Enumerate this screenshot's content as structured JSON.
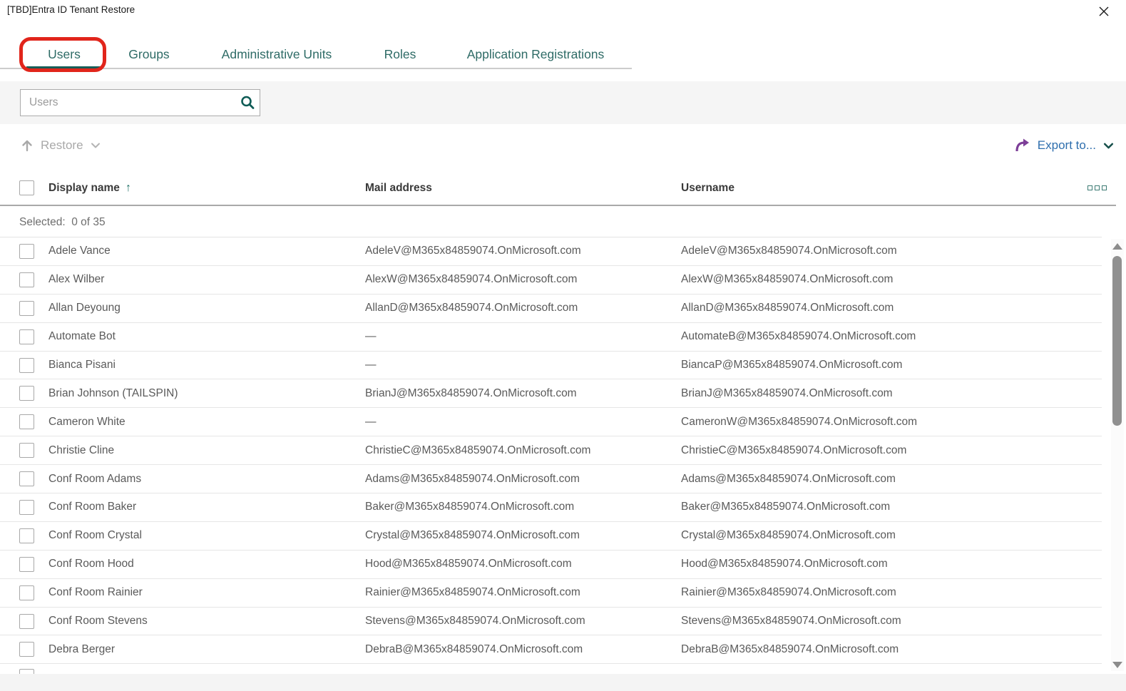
{
  "window": {
    "title": "[TBD]Entra ID Tenant Restore"
  },
  "tabs": [
    {
      "label": "Users",
      "active": true,
      "annotated": true
    },
    {
      "label": "Groups",
      "active": false
    },
    {
      "label": "Administrative Units",
      "active": false
    },
    {
      "label": "Roles",
      "active": false
    },
    {
      "label": "Application Registrations",
      "active": false
    }
  ],
  "search": {
    "placeholder": "Users",
    "icon": "search-icon"
  },
  "toolbar": {
    "restore_label": "Restore",
    "restore_enabled": false,
    "export_label": "Export to...",
    "icons": [
      "up-arrow-icon",
      "chevron-down-icon",
      "export-arrow-icon"
    ]
  },
  "colors": {
    "accent_teal": "#175e58",
    "annotation_red": "#e1251b",
    "export_blue": "#2f6fae",
    "export_purple": "#7d3f98",
    "disabled_grey": "#a9a9a9"
  },
  "table": {
    "columns": [
      "Display name",
      "Mail address",
      "Username"
    ],
    "sort": {
      "column": "Display name",
      "direction": "ascending"
    },
    "selected_summary": "Selected:  0 of 35",
    "rows": [
      {
        "display_name": "Adele Vance",
        "mail": "AdeleV@M365x84859074.OnMicrosoft.com",
        "username": "AdeleV@M365x84859074.OnMicrosoft.com"
      },
      {
        "display_name": "Alex Wilber",
        "mail": "AlexW@M365x84859074.OnMicrosoft.com",
        "username": "AlexW@M365x84859074.OnMicrosoft.com"
      },
      {
        "display_name": "Allan Deyoung",
        "mail": "AllanD@M365x84859074.OnMicrosoft.com",
        "username": "AllanD@M365x84859074.OnMicrosoft.com"
      },
      {
        "display_name": "Automate Bot",
        "mail": "—",
        "username": "AutomateB@M365x84859074.OnMicrosoft.com"
      },
      {
        "display_name": "Bianca Pisani",
        "mail": "—",
        "username": "BiancaP@M365x84859074.OnMicrosoft.com"
      },
      {
        "display_name": "Brian Johnson (TAILSPIN)",
        "mail": "BrianJ@M365x84859074.OnMicrosoft.com",
        "username": "BrianJ@M365x84859074.OnMicrosoft.com"
      },
      {
        "display_name": "Cameron White",
        "mail": "—",
        "username": "CameronW@M365x84859074.OnMicrosoft.com"
      },
      {
        "display_name": "Christie Cline",
        "mail": "ChristieC@M365x84859074.OnMicrosoft.com",
        "username": "ChristieC@M365x84859074.OnMicrosoft.com"
      },
      {
        "display_name": "Conf Room Adams",
        "mail": "Adams@M365x84859074.OnMicrosoft.com",
        "username": "Adams@M365x84859074.OnMicrosoft.com"
      },
      {
        "display_name": "Conf Room Baker",
        "mail": "Baker@M365x84859074.OnMicrosoft.com",
        "username": "Baker@M365x84859074.OnMicrosoft.com"
      },
      {
        "display_name": "Conf Room Crystal",
        "mail": "Crystal@M365x84859074.OnMicrosoft.com",
        "username": "Crystal@M365x84859074.OnMicrosoft.com"
      },
      {
        "display_name": "Conf Room Hood",
        "mail": "Hood@M365x84859074.OnMicrosoft.com",
        "username": "Hood@M365x84859074.OnMicrosoft.com"
      },
      {
        "display_name": "Conf Room Rainier",
        "mail": "Rainier@M365x84859074.OnMicrosoft.com",
        "username": "Rainier@M365x84859074.OnMicrosoft.com"
      },
      {
        "display_name": "Conf Room Stevens",
        "mail": "Stevens@M365x84859074.OnMicrosoft.com",
        "username": "Stevens@M365x84859074.OnMicrosoft.com"
      },
      {
        "display_name": "Debra Berger",
        "mail": "DebraB@M365x84859074.OnMicrosoft.com",
        "username": "DebraB@M365x84859074.OnMicrosoft.com"
      }
    ]
  }
}
